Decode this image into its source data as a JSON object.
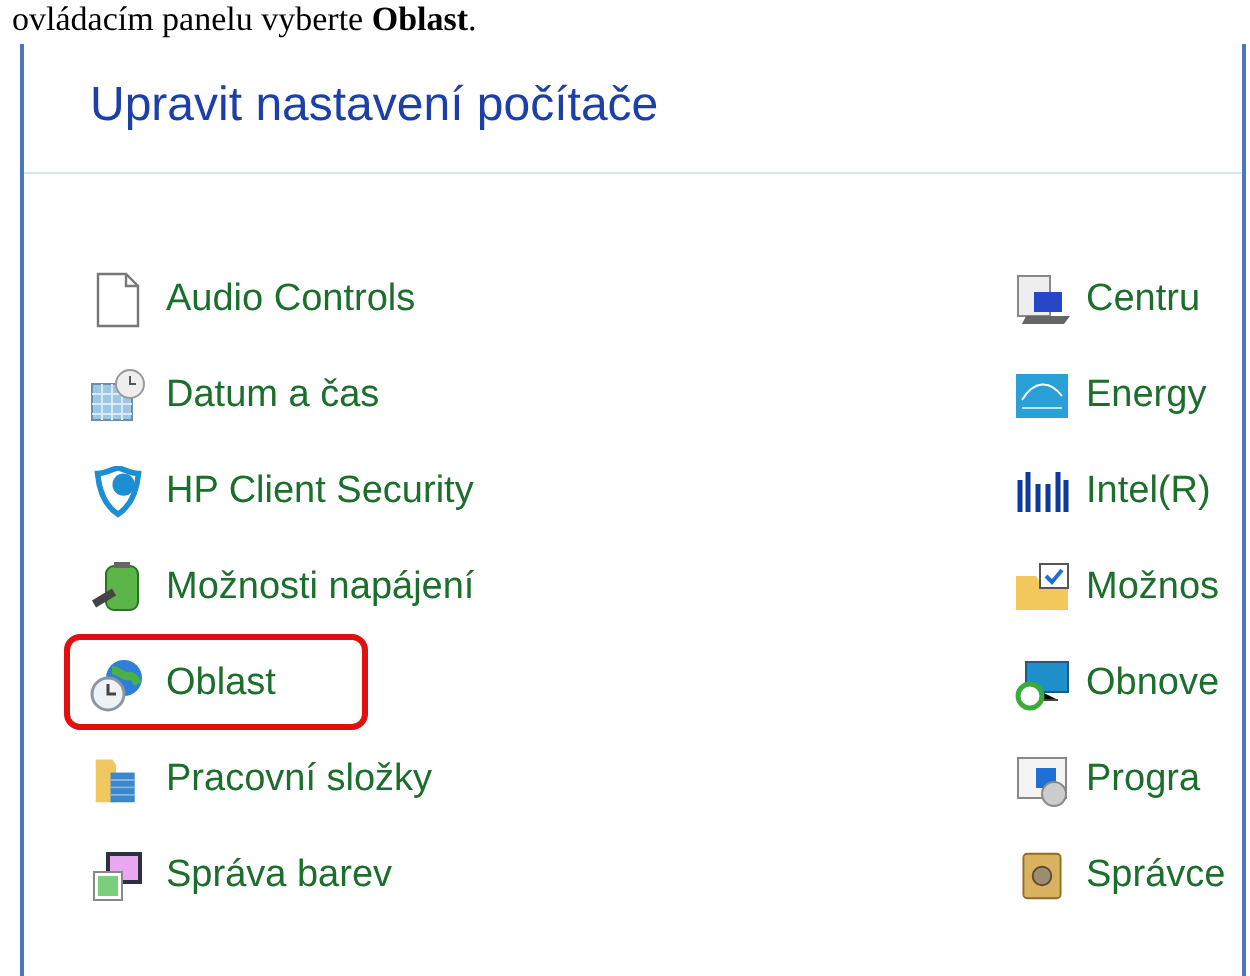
{
  "document_text": "ovládacím panelu vyberte **Oblast**.",
  "panel": {
    "title": "Upravit nastavení počítače",
    "left_items": [
      {
        "label": "Audio Controls",
        "highlighted": false
      },
      {
        "label": "Datum a čas",
        "highlighted": false
      },
      {
        "label": "HP Client Security",
        "highlighted": false
      },
      {
        "label": "Možnosti napájení",
        "highlighted": false
      },
      {
        "label": "Oblast",
        "highlighted": true
      },
      {
        "label": "Pracovní složky",
        "highlighted": false
      },
      {
        "label": "Správa barev",
        "highlighted": false
      }
    ],
    "right_items": [
      {
        "label": "Centru"
      },
      {
        "label": "Energy"
      },
      {
        "label": "Intel(R)"
      },
      {
        "label": "Možnos"
      },
      {
        "label": "Obnove"
      },
      {
        "label": "Progra"
      },
      {
        "label": "Správce"
      }
    ]
  }
}
